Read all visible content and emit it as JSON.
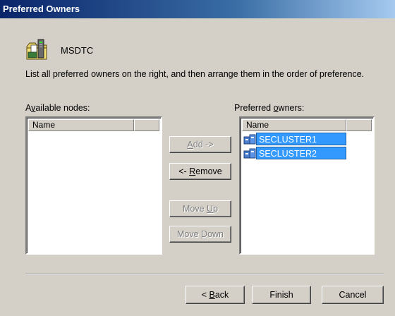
{
  "window": {
    "title": "Preferred Owners"
  },
  "resource": {
    "name": "MSDTC",
    "icon": "resource-folder-icon"
  },
  "instructions": "List all preferred owners on the right, and then arrange them in the order of preference.",
  "available": {
    "label": "Available nodes:",
    "column_header": "Name",
    "items": []
  },
  "preferred": {
    "label": "Preferred owners:",
    "column_header": "Name",
    "items": [
      {
        "name": "SECLUSTER1",
        "icon": "cluster-node-icon",
        "selected": true
      },
      {
        "name": "SECLUSTER2",
        "icon": "cluster-node-icon",
        "selected": true
      }
    ]
  },
  "buttons": {
    "add": {
      "label": "Add ->",
      "enabled": false
    },
    "remove": {
      "label": "<- Remove",
      "enabled": true
    },
    "move_up": {
      "label": "Move Up",
      "enabled": false
    },
    "move_down": {
      "label": "Move Down",
      "enabled": false
    },
    "back": {
      "label": "< Back"
    },
    "finish": {
      "label": "Finish"
    },
    "cancel": {
      "label": "Cancel"
    }
  },
  "colors": {
    "title_bar": "#0a246a",
    "selection": "#3399ff",
    "dialog_bg": "#d4d0c8"
  }
}
